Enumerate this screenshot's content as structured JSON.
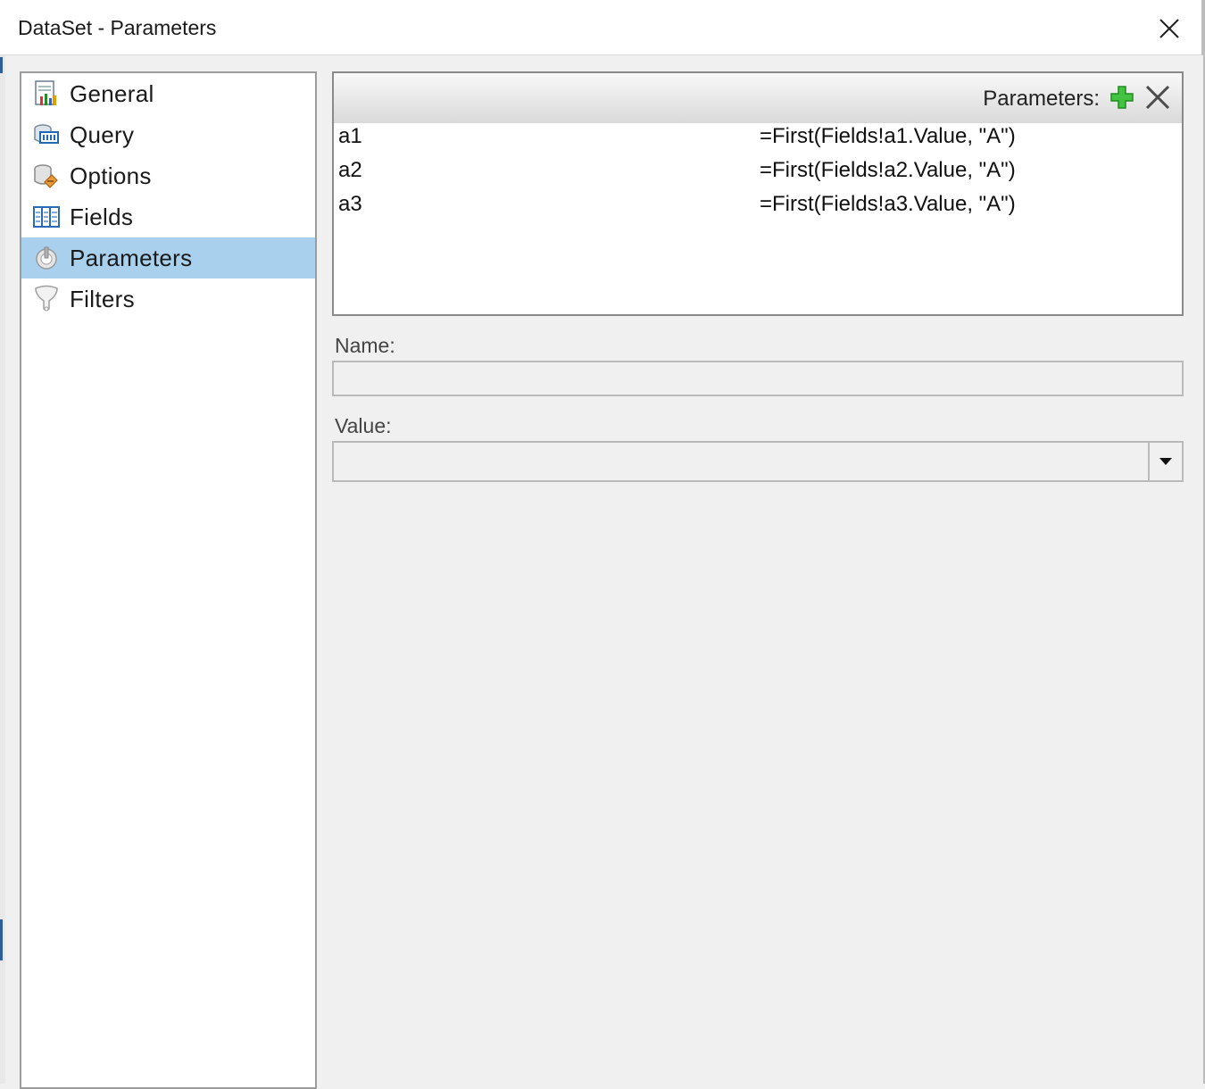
{
  "window": {
    "title": "DataSet - Parameters"
  },
  "sidebar": {
    "items": [
      {
        "label": "General",
        "icon": "general-report-icon",
        "active": false
      },
      {
        "label": "Query",
        "icon": "query-database-icon",
        "active": false
      },
      {
        "label": "Options",
        "icon": "options-icon",
        "active": false
      },
      {
        "label": "Fields",
        "icon": "fields-columns-icon",
        "active": false
      },
      {
        "label": "Parameters",
        "icon": "parameters-icon",
        "active": true
      },
      {
        "label": "Filters",
        "icon": "filter-funnel-icon",
        "active": false
      }
    ]
  },
  "parameters_panel": {
    "header_label": "Parameters:",
    "add_icon": "add-plus-icon",
    "delete_icon": "delete-x-icon",
    "rows": [
      {
        "name": "a1",
        "value": "=First(Fields!a1.Value, \"A\")"
      },
      {
        "name": "a2",
        "value": "=First(Fields!a2.Value, \"A\")"
      },
      {
        "name": "a3",
        "value": "=First(Fields!a3.Value, \"A\")"
      }
    ]
  },
  "form": {
    "name_label": "Name:",
    "name_value": "",
    "value_label": "Value:",
    "value_value": ""
  },
  "colors": {
    "selected_item": "#a9d1ee",
    "add_green": "#3cb83c",
    "window_bg": "#f0f0f0"
  }
}
